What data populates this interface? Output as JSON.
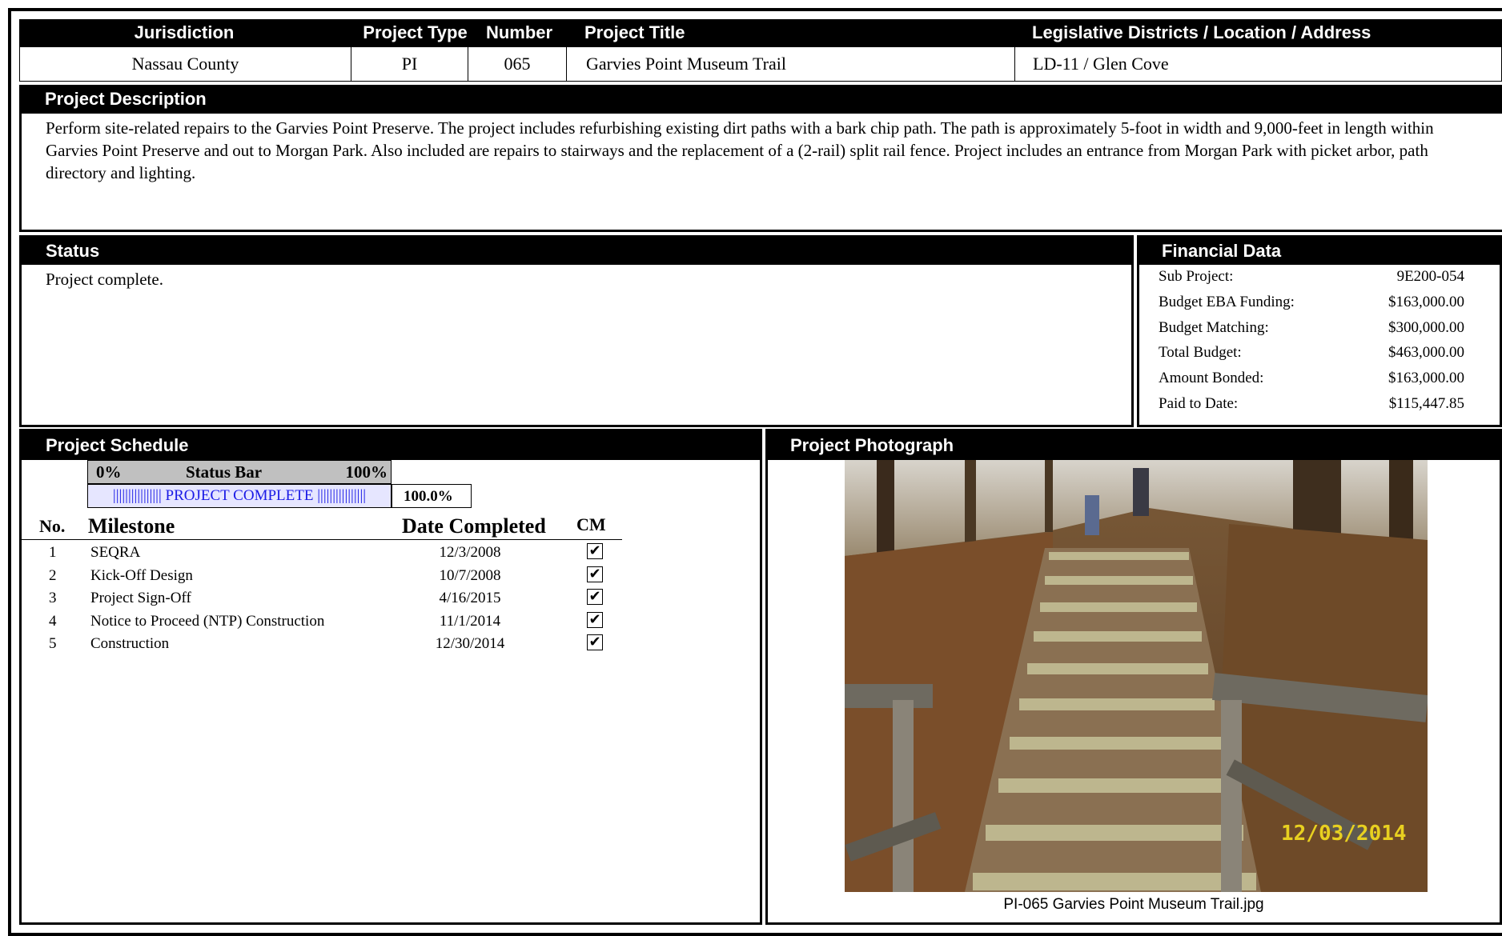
{
  "header": {
    "col_jurisdiction": "Jurisdiction",
    "col_type": "Project Type",
    "col_number": "Number",
    "col_title": "Project Title",
    "col_location": "Legislative Districts / Location / Address"
  },
  "project": {
    "jurisdiction": "Nassau County",
    "type": "PI",
    "number": "065",
    "title": "Garvies Point Museum Trail",
    "location": "LD-11 / Glen Cove"
  },
  "description": {
    "heading": "Project Description",
    "text": "Perform site-related repairs to the Garvies Point Preserve. The project includes refurbishing existing dirt paths with a bark chip path. The path is approximately 5-foot in width and 9,000-feet in length within Garvies Point Preserve and out to Morgan Park. Also included are repairs to stairways and the replacement of a (2-rail) split rail fence. Project includes an entrance from Morgan Park with picket arbor, path directory and lighting."
  },
  "status": {
    "heading": "Status",
    "text": "Project complete."
  },
  "financial": {
    "heading": "Financial Data",
    "rows": [
      {
        "label": "Sub Project:",
        "value": "9E200-054"
      },
      {
        "label": "Budget EBA Funding:",
        "value": "$163,000.00"
      },
      {
        "label": "Budget Matching:",
        "value": "$300,000.00"
      },
      {
        "label": "Total Budget:",
        "value": "$463,000.00"
      },
      {
        "label": "Amount Bonded:",
        "value": "$163,000.00"
      },
      {
        "label": "Paid to Date:",
        "value": "$115,447.85"
      }
    ]
  },
  "schedule": {
    "heading": "Project Schedule",
    "bar_min": "0%",
    "bar_title": "Status Bar",
    "bar_max": "100%",
    "bar_text": "|||||||||||||||| PROJECT COMPLETE ||||||||||||||||",
    "progress": 1.0,
    "percent_label": "100.0%",
    "col_no": "No.",
    "col_milestone": "Milestone",
    "col_date": "Date Completed",
    "col_cm": "CM",
    "milestones": [
      {
        "no": "1",
        "name": "SEQRA",
        "date": "12/3/2008",
        "cm": true
      },
      {
        "no": "2",
        "name": "Kick-Off Design",
        "date": "10/7/2008",
        "cm": true
      },
      {
        "no": "3",
        "name": "Project Sign-Off",
        "date": "4/16/2015",
        "cm": true
      },
      {
        "no": "4",
        "name": "Notice to Proceed (NTP) Construction",
        "date": "11/1/2014",
        "cm": true
      },
      {
        "no": "5",
        "name": "Construction",
        "date": "12/30/2014",
        "cm": true
      }
    ]
  },
  "photo": {
    "heading": "Project Photograph",
    "caption": "PI-065 Garvies Point Museum Trail.jpg",
    "stamp": "12/03/2014"
  }
}
